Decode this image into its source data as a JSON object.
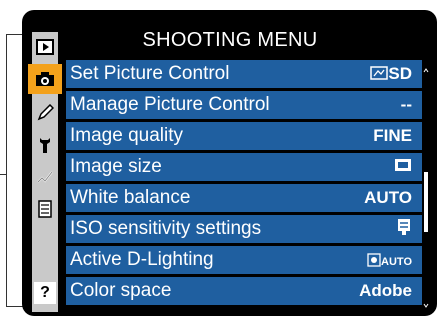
{
  "menu_title": "SHOOTING MENU",
  "sidebar": {
    "tabs": [
      {
        "icon": "playback-icon",
        "active": false
      },
      {
        "icon": "camera-icon",
        "active": true
      },
      {
        "icon": "pencil-icon",
        "active": false
      },
      {
        "icon": "wrench-icon",
        "active": false
      },
      {
        "icon": "retouch-icon",
        "active": false
      },
      {
        "icon": "recent-settings-icon",
        "active": false
      }
    ],
    "help_label": "?"
  },
  "items": [
    {
      "label": "Set Picture Control",
      "value": "SD",
      "value_icon": "picture-control-icon"
    },
    {
      "label": "Manage Picture Control",
      "value": "--"
    },
    {
      "label": "Image quality",
      "value": "FINE"
    },
    {
      "label": "Image size",
      "value": "",
      "value_icon": "image-size-icon"
    },
    {
      "label": "White balance",
      "value": "AUTO"
    },
    {
      "label": "ISO sensitivity settings",
      "value": "",
      "value_icon": "iso-icon"
    },
    {
      "label": "Active D-Lighting",
      "value": "AUTO",
      "value_icon": "d-lighting-icon"
    },
    {
      "label": "Color space",
      "value": "Adobe"
    }
  ],
  "colors": {
    "row_bg": "#1f5fa0",
    "active_tab": "#f3a11b",
    "sidebar_bg": "#c9c9c9"
  }
}
